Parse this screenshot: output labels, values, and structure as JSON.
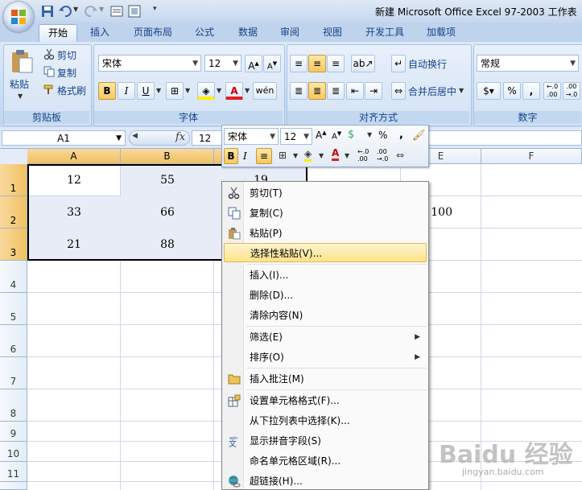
{
  "window": {
    "title": "新建 Microsoft Office Excel 97-2003 工作表"
  },
  "tabs": [
    "开始",
    "插入",
    "页面布局",
    "公式",
    "数据",
    "审阅",
    "视图",
    "开发工具",
    "加载项"
  ],
  "clipboard": {
    "paste_label": "粘贴",
    "cut_label": "剪切",
    "copy_label": "复制",
    "format_painter_label": "格式刷",
    "group_label": "剪贴板"
  },
  "font": {
    "name": "宋体",
    "size": "12",
    "group_label": "字体"
  },
  "alignment": {
    "wrap_label": "自动换行",
    "merge_label": "合并后居中",
    "group_label": "对齐方式"
  },
  "number": {
    "format": "常规",
    "percent": "%",
    "comma": ",",
    "group_label": "数字"
  },
  "formula_bar": {
    "name_box": "A1",
    "fx": "fx",
    "value": "12"
  },
  "columns": [
    "A",
    "B",
    "C",
    "D",
    "E",
    "F"
  ],
  "rows": [
    "1",
    "2",
    "3",
    "4",
    "5",
    "6",
    "7",
    "8",
    "9",
    "10",
    "11"
  ],
  "cells": {
    "A1": "12",
    "B1": "55",
    "C1": "19",
    "A2": "33",
    "B2": "66",
    "E2": "100",
    "A3": "21",
    "B3": "88"
  },
  "mini_toolbar": {
    "font": "宋体",
    "size": "12",
    "percent": "%",
    "comma": ","
  },
  "context_menu": [
    {
      "label": "剪切(T)",
      "icon": "scissors-icon"
    },
    {
      "label": "复制(C)",
      "icon": "copy-icon"
    },
    {
      "label": "粘贴(P)",
      "icon": "paste-icon"
    },
    {
      "label": "选择性粘贴(V)...",
      "icon": "",
      "highlight": true
    },
    {
      "label": "插入(I)...",
      "icon": ""
    },
    {
      "label": "删除(D)...",
      "icon": ""
    },
    {
      "label": "清除内容(N)",
      "icon": ""
    },
    {
      "label": "筛选(E)",
      "icon": "",
      "submenu": true
    },
    {
      "label": "排序(O)",
      "icon": "",
      "submenu": true
    },
    {
      "label": "插入批注(M)",
      "icon": "comment-icon"
    },
    {
      "label": "设置单元格格式(F)...",
      "icon": "format-cells-icon"
    },
    {
      "label": "从下拉列表中选择(K)...",
      "icon": ""
    },
    {
      "label": "显示拼音字段(S)",
      "icon": "phonetic-icon"
    },
    {
      "label": "命名单元格区域(R)...",
      "icon": ""
    },
    {
      "label": "超链接(H)...",
      "icon": "hyperlink-icon"
    }
  ],
  "watermark": {
    "text": "Baidu 经验",
    "url": "jingyan.baidu.com"
  }
}
